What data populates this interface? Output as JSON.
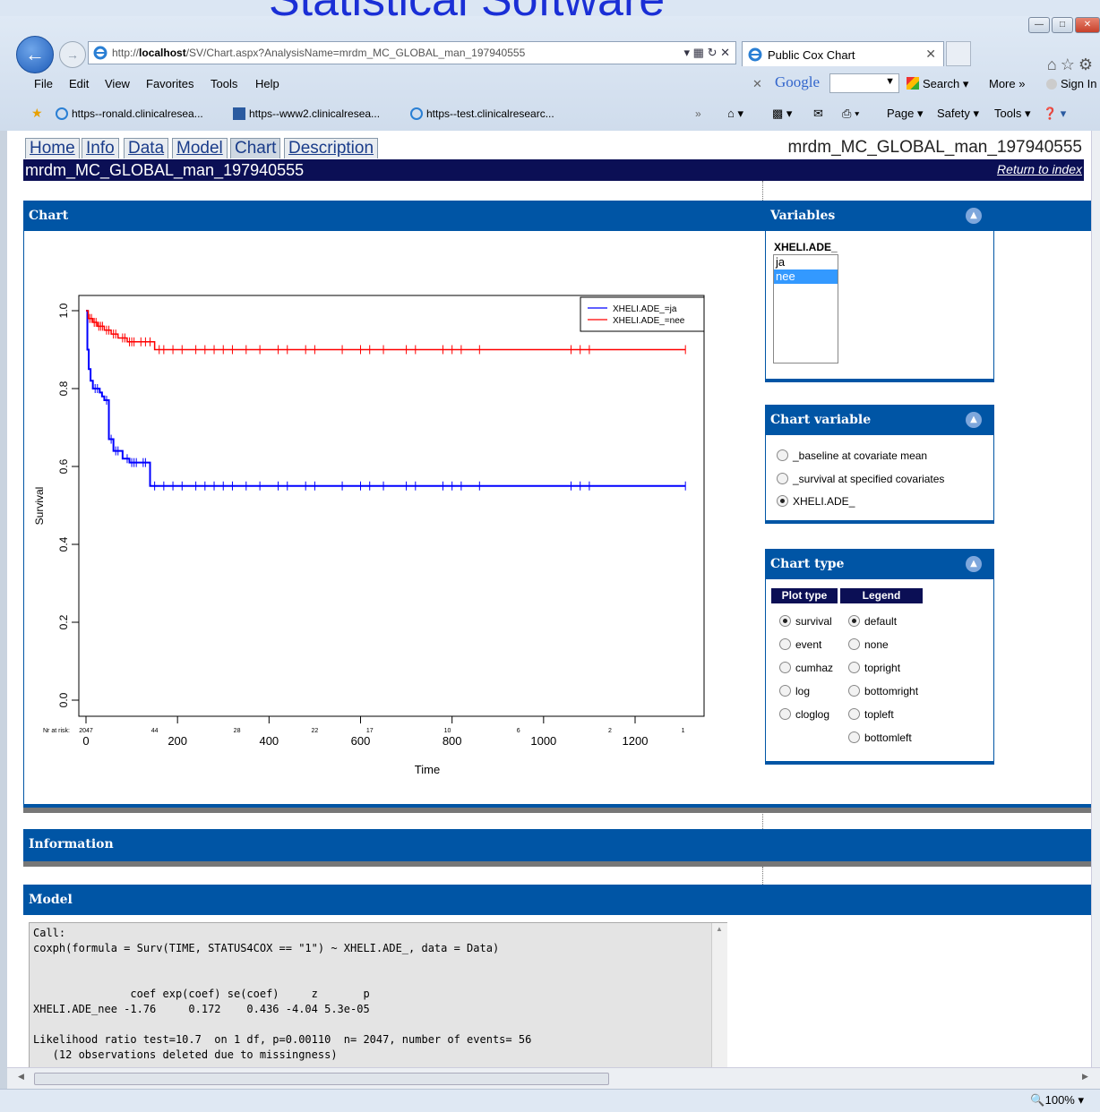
{
  "banner_text": "Statistical Software",
  "browser": {
    "url_prefix": "http://",
    "url_host": "localhost",
    "url_rest": "/SV/Chart.aspx?AnalysisName=mrdm_MC_GLOBAL_man_197940555",
    "tab_title": "Public Cox Chart",
    "menu": [
      "File",
      "Edit",
      "View",
      "Favorites",
      "Tools",
      "Help"
    ],
    "google_label": "Google",
    "search_label": "Search",
    "more_label": "More",
    "signin_label": "Sign In",
    "favorites": [
      "https--ronald.clinicalresea...",
      "https--www2.clinicalresea...",
      "https--test.clinicalresearc..."
    ],
    "commands": [
      "Page",
      "Safety",
      "Tools"
    ],
    "zoom": "100%"
  },
  "nav": {
    "tabs": [
      "Home",
      "Info",
      "Data",
      "Model",
      "Chart",
      "Description"
    ],
    "active": "Chart",
    "analysis_name": "mrdm_MC_GLOBAL_man_197940555",
    "title": "mrdm_MC_GLOBAL_man_197940555",
    "return_link": "Return to index"
  },
  "panels": {
    "chart": "Chart",
    "variables": "Variables",
    "chart_variable": "Chart variable",
    "chart_type": "Chart type",
    "information": "Information",
    "model": "Model"
  },
  "variables": {
    "name": "XHELI.ADE_",
    "options": [
      "ja",
      "nee"
    ],
    "selected": "nee"
  },
  "chart_variable": {
    "options": [
      "_baseline at covariate mean",
      "_survival at specified covariates",
      "XHELI.ADE_"
    ],
    "selected": "XHELI.ADE_"
  },
  "chart_type": {
    "plot_type_header": "Plot type",
    "legend_header": "Legend",
    "plot_types": [
      "survival",
      "event",
      "cumhaz",
      "log",
      "cloglog"
    ],
    "plot_selected": "survival",
    "legends": [
      "default",
      "none",
      "topright",
      "bottomright",
      "topleft",
      "bottomleft"
    ],
    "legend_selected": "default"
  },
  "model_output": "Call:\ncoxph(formula = Surv(TIME, STATUS4COX == \"1\") ~ XHELI.ADE_, data = Data)\n\n\n               coef exp(coef) se(coef)     z       p\nXHELI.ADE_nee -1.76     0.172    0.436 -4.04 5.3e-05\n\nLikelihood ratio test=10.7  on 1 df, p=0.00110  n= 2047, number of events= 56\n   (12 observations deleted due to missingness)",
  "chart_data": {
    "type": "line",
    "title": "",
    "xlabel": "Time",
    "ylabel": "Survival",
    "xlim": [
      0,
      1300
    ],
    "ylim": [
      0,
      1.0
    ],
    "x_ticks": [
      0,
      200,
      400,
      600,
      800,
      1000,
      1200
    ],
    "y_ticks": [
      0.0,
      0.2,
      0.4,
      0.6,
      0.8,
      1.0
    ],
    "legend_position": "top-right",
    "risk_label": "Nr at risk:",
    "risk_x": [
      0,
      150,
      330,
      500,
      620,
      790,
      945,
      1145,
      1305
    ],
    "risk_counts": [
      "2047",
      "44",
      "28",
      "22",
      "17",
      "10",
      "6",
      "2",
      "1"
    ],
    "series": [
      {
        "name": "XHELI.ADE_=ja",
        "color": "#0000ff",
        "x": [
          0,
          3,
          6,
          10,
          15,
          30,
          35,
          40,
          50,
          60,
          80,
          95,
          120,
          140,
          1310
        ],
        "y": [
          1.0,
          0.9,
          0.85,
          0.82,
          0.8,
          0.79,
          0.78,
          0.77,
          0.67,
          0.64,
          0.62,
          0.61,
          0.61,
          0.55,
          0.55
        ],
        "censor_x": [
          20,
          25,
          45,
          55,
          65,
          70,
          90,
          100,
          105,
          110,
          125,
          130,
          150,
          170,
          190,
          210,
          240,
          260,
          280,
          300,
          320,
          350,
          380,
          420,
          440,
          480,
          500,
          560,
          600,
          620,
          650,
          700,
          720,
          780,
          800,
          820,
          860,
          1060,
          1080,
          1100,
          1310
        ]
      },
      {
        "name": "XHELI.ADE_=nee",
        "color": "#ff0000",
        "x": [
          0,
          5,
          15,
          25,
          40,
          55,
          70,
          90,
          110,
          150,
          1310
        ],
        "y": [
          1.0,
          0.98,
          0.97,
          0.96,
          0.95,
          0.94,
          0.93,
          0.92,
          0.92,
          0.9,
          0.9
        ],
        "censor_x": [
          8,
          12,
          18,
          22,
          28,
          32,
          36,
          45,
          50,
          60,
          65,
          80,
          85,
          95,
          100,
          105,
          120,
          130,
          140,
          160,
          170,
          190,
          210,
          240,
          260,
          280,
          300,
          320,
          350,
          380,
          420,
          440,
          480,
          500,
          560,
          600,
          620,
          650,
          700,
          720,
          780,
          800,
          820,
          860,
          1060,
          1080,
          1100,
          1310
        ]
      }
    ]
  }
}
